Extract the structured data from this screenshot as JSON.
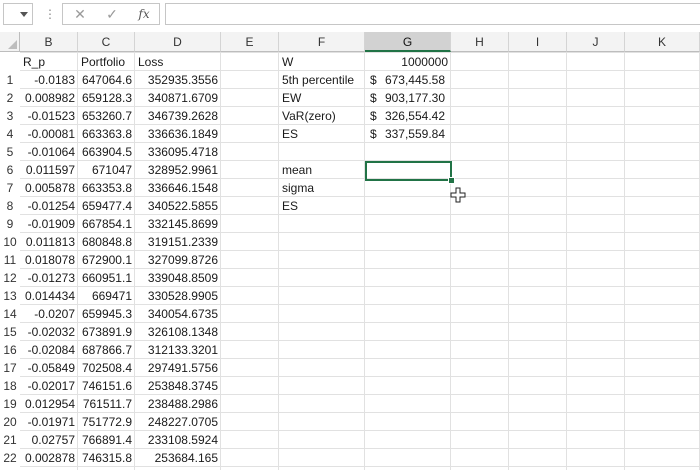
{
  "formula_bar": {
    "cancel_icon": "✕",
    "enter_icon": "✓",
    "fx_label": "fx",
    "value": ""
  },
  "columns": [
    "B",
    "C",
    "D",
    "E",
    "F",
    "G",
    "H",
    "I",
    "J",
    "K"
  ],
  "selected_column": "G",
  "table_headers": {
    "B": "R_p",
    "C": "Portfolio",
    "D": "Loss"
  },
  "rows": [
    {
      "n": "1",
      "r_p": "-0.0183",
      "portfolio": "647064.6",
      "loss": "352935.3556"
    },
    {
      "n": "2",
      "r_p": "0.008982",
      "portfolio": "659128.3",
      "loss": "340871.6709"
    },
    {
      "n": "3",
      "r_p": "-0.01523",
      "portfolio": "653260.7",
      "loss": "346739.2628"
    },
    {
      "n": "4",
      "r_p": "-0.00081",
      "portfolio": "663363.8",
      "loss": "336636.1849"
    },
    {
      "n": "5",
      "r_p": "-0.01064",
      "portfolio": "663904.5",
      "loss": "336095.4718"
    },
    {
      "n": "6",
      "r_p": "0.011597",
      "portfolio": "671047",
      "loss": "328952.9961"
    },
    {
      "n": "7",
      "r_p": "0.005878",
      "portfolio": "663353.8",
      "loss": "336646.1548"
    },
    {
      "n": "8",
      "r_p": "-0.01254",
      "portfolio": "659477.4",
      "loss": "340522.5855"
    },
    {
      "n": "9",
      "r_p": "-0.01909",
      "portfolio": "667854.1",
      "loss": "332145.8699"
    },
    {
      "n": "10",
      "r_p": "0.011813",
      "portfolio": "680848.8",
      "loss": "319151.2339"
    },
    {
      "n": "11",
      "r_p": "0.018078",
      "portfolio": "672900.1",
      "loss": "327099.8726"
    },
    {
      "n": "12",
      "r_p": "-0.01273",
      "portfolio": "660951.1",
      "loss": "339048.8509"
    },
    {
      "n": "13",
      "r_p": "0.014434",
      "portfolio": "669471",
      "loss": "330528.9905"
    },
    {
      "n": "14",
      "r_p": "-0.0207",
      "portfolio": "659945.3",
      "loss": "340054.6735"
    },
    {
      "n": "15",
      "r_p": "-0.02032",
      "portfolio": "673891.9",
      "loss": "326108.1348"
    },
    {
      "n": "16",
      "r_p": "-0.02084",
      "portfolio": "687866.7",
      "loss": "312133.3201"
    },
    {
      "n": "17",
      "r_p": "-0.05849",
      "portfolio": "702508.4",
      "loss": "297491.5756"
    },
    {
      "n": "18",
      "r_p": "-0.02017",
      "portfolio": "746151.6",
      "loss": "253848.3745"
    },
    {
      "n": "19",
      "r_p": "0.012954",
      "portfolio": "761511.7",
      "loss": "238488.2986"
    },
    {
      "n": "20",
      "r_p": "-0.01971",
      "portfolio": "751772.9",
      "loss": "248227.0705"
    },
    {
      "n": "21",
      "r_p": "0.02757",
      "portfolio": "766891.4",
      "loss": "233108.5924"
    },
    {
      "n": "22",
      "r_p": "0.002878",
      "portfolio": "746315.8",
      "loss": "253684.165"
    }
  ],
  "summary": [
    {
      "label": "W",
      "currency": "",
      "value": "1000000"
    },
    {
      "label": "5th percentile",
      "currency": "$",
      "value": "673,445.58"
    },
    {
      "label": "EW",
      "currency": "$",
      "value": "903,177.30"
    },
    {
      "label": "VaR(zero)",
      "currency": "$",
      "value": "326,554.42"
    },
    {
      "label": "ES",
      "currency": "$",
      "value": "337,559.84"
    }
  ],
  "stats_labels": [
    "mean",
    "sigma",
    "ES"
  ],
  "colors": {
    "accent": "#217346",
    "header_bg": "#f3f3f3",
    "gridline": "#e1e1e1"
  }
}
